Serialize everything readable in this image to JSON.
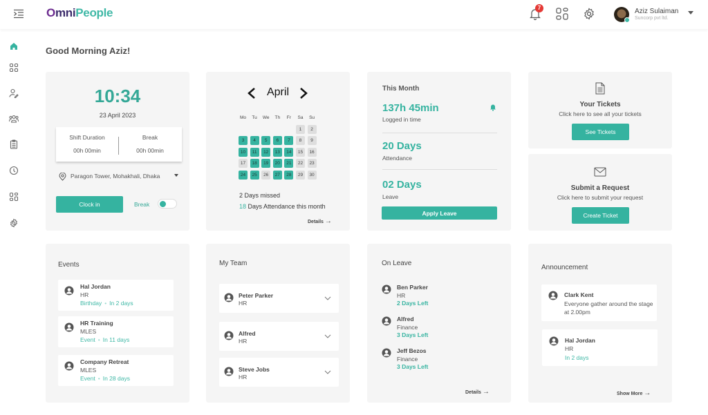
{
  "app": {
    "logo": {
      "o": "O",
      "mni": "mni",
      "people": "People"
    },
    "colors": {
      "accent": "#35b3a0",
      "badge": "#e53935",
      "card_bg": "#f5f5f5"
    }
  },
  "header": {
    "icons": [
      "menu-toggle-icon",
      "bell-icon",
      "apps-grid-icon",
      "gear-icon"
    ],
    "notification_count": "7",
    "user": {
      "name": "Aziz Sulaiman",
      "org": "Suncorp pvt ltd.",
      "status": "online"
    }
  },
  "sidebar": {
    "items": [
      {
        "icon": "home-icon",
        "active": true
      },
      {
        "icon": "dashboard-grid-icon"
      },
      {
        "icon": "user-edit-icon"
      },
      {
        "icon": "team-icon"
      },
      {
        "icon": "clipboard-icon"
      },
      {
        "icon": "clock-icon"
      },
      {
        "icon": "apps-grid-icon"
      },
      {
        "icon": "settings-icon"
      }
    ]
  },
  "greeting": "Good Morning Aziz!",
  "clock": {
    "time": "10:34",
    "date": "23 April 2023",
    "shift_label": "Shift Duration",
    "shift_value": "00h 00min",
    "break_label": "Break",
    "break_value": "00h 00min",
    "location": "Paragon Tower, Mohakhali, Dhaka",
    "clockin_button": "Clock in",
    "break_toggle_label": "Break",
    "break_toggle_on": true
  },
  "calendar": {
    "month": "April",
    "weekdays": [
      "Mo",
      "Tu",
      "We",
      "Th",
      "Fr",
      "Sa",
      "Su"
    ],
    "leading_blanks": 5,
    "days_in_month": 30,
    "attended_days": [
      3,
      4,
      5,
      6,
      7,
      10,
      11,
      12,
      13,
      14,
      18,
      19,
      20,
      21,
      24,
      25,
      27,
      28
    ],
    "missed_text": "2 Days missed",
    "attendance_count": "18",
    "attendance_text": " Days Attendance this month",
    "details_label": "Details"
  },
  "this_month": {
    "title": "This Month",
    "stats": [
      {
        "value": "137h 45min",
        "label": "Logged in time"
      },
      {
        "value": "20 Days",
        "label": "Attendance"
      },
      {
        "value": "02 Days",
        "label": "Leave"
      }
    ],
    "apply_button": "Apply Leave"
  },
  "tickets": {
    "title": "Your Tickets",
    "subtitle": "Click here to see all your tickets",
    "button": "See Tickets"
  },
  "request": {
    "title": "Submit a Request",
    "subtitle": "Click here to submit your request",
    "button": "Create Ticket"
  },
  "events": {
    "title": "Events",
    "items": [
      {
        "name": "Hal Jordan",
        "dept": "HR",
        "type": "Birthday",
        "when": "In 2 days"
      },
      {
        "name": "HR Training",
        "dept": "MLES",
        "type": "Event",
        "when": "In 11 days"
      },
      {
        "name": "Company Retreat",
        "dept": "MLES",
        "type": "Event",
        "when": "In 28 days"
      }
    ]
  },
  "team": {
    "title": "My Team",
    "members": [
      {
        "name": "Peter Parker",
        "dept": "HR"
      },
      {
        "name": "Alfred",
        "dept": "HR"
      },
      {
        "name": "Steve Jobs",
        "dept": "HR"
      }
    ]
  },
  "on_leave": {
    "title": "On Leave",
    "items": [
      {
        "name": "Ben Parker",
        "dept": "HR",
        "left": "2 Days Left"
      },
      {
        "name": "Alfred",
        "dept": "Finance",
        "left": "3 Days Left"
      },
      {
        "name": "Jeff Bezos",
        "dept": "Finance",
        "left": "3 Days Left"
      }
    ],
    "details_label": "Details"
  },
  "announcement": {
    "title": "Announcement",
    "items": [
      {
        "name": "Clark Kent",
        "text": "Everyone gather around the stage at 2.00pm"
      },
      {
        "name": "Hal Jordan",
        "dept": "HR",
        "when": "In 2 days"
      }
    ],
    "show_more_label": "Show More"
  }
}
